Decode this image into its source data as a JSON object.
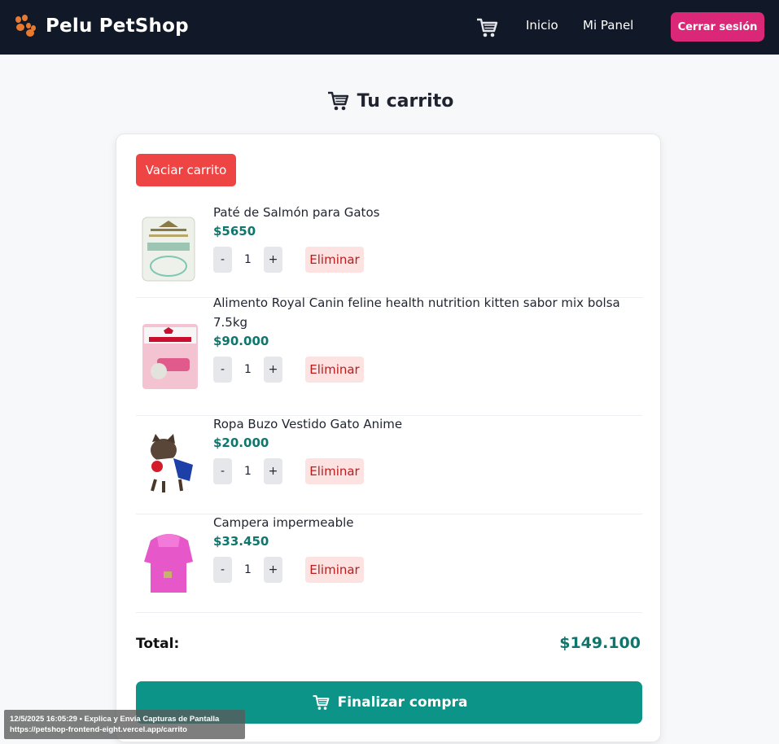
{
  "navbar": {
    "brand": "Pelu PetShop",
    "links": [
      "Inicio",
      "Mi Panel"
    ],
    "logout_label": "Cerrar sesión"
  },
  "page": {
    "title": "Tu carrito"
  },
  "cart": {
    "clear_label": "Vaciar carrito",
    "remove_label": "Eliminar",
    "items": [
      {
        "name": "Paté de Salmón para Gatos",
        "price": "$5650",
        "qty": "1"
      },
      {
        "name": "Alimento Royal Canin feline health nutrition kitten sabor mix bolsa 7.5kg",
        "price": "$90.000",
        "qty": "1"
      },
      {
        "name": "Ropa Buzo Vestido Gato Anime",
        "price": "$20.000",
        "qty": "1"
      },
      {
        "name": "Campera impermeable",
        "price": "$33.450",
        "qty": "1"
      }
    ],
    "decrement": "-",
    "increment": "+",
    "total_label": "Total:",
    "total_value": "$149.100",
    "checkout_label": "Finalizar compra"
  },
  "overlay": {
    "line1": "12/5/2025 16:05:29 • Explica y Envía Capturas de Pantalla",
    "line2": "https://petshop-frontend-eight.vercel.app/carrito"
  },
  "colors": {
    "navbar_bg": "#111827",
    "logout": "#db2777",
    "clear": "#ef4444",
    "price": "#0f766e",
    "checkout": "#0d9488"
  }
}
